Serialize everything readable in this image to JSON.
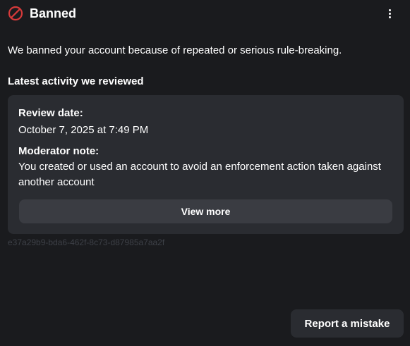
{
  "header": {
    "title": "Banned",
    "icon": "ban-icon",
    "menu_icon": "more-vertical-icon"
  },
  "description": "We banned your account because of repeated or serious rule-breaking.",
  "activity": {
    "section_title": "Latest activity we reviewed",
    "review_date_label": "Review date:",
    "review_date_value": "October 7, 2025 at 7:49 PM",
    "moderator_note_label": "Moderator note:",
    "moderator_note_value": "You created or used an account to avoid an enforcement action taken against another account",
    "view_more_label": "View more"
  },
  "reference_id": "e37a29b9-bda6-462f-8c73-d87985a7aa2f",
  "footer": {
    "report_label": "Report a mistake"
  },
  "colors": {
    "background": "#1a1b1e",
    "card": "#2a2c31",
    "button": "#3a3c42",
    "ban_red": "#d63a3a",
    "muted_text": "#3d4047"
  }
}
